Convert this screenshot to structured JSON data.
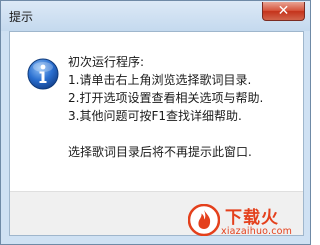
{
  "window": {
    "title": "提示",
    "close_symbol": "✕"
  },
  "message": {
    "icon": "information-icon",
    "lines": [
      "初次运行程序:",
      "1.请单击右上角浏览选择歌词目录.",
      "2.打开选项设置查看相关选项与帮助.",
      "3.其他问题可按F1查找详细帮助."
    ],
    "footer": "选择歌词目录后将不再提示此窗口."
  },
  "watermark": {
    "brand": "下载火",
    "url": "xiazaihuo.com"
  },
  "colors": {
    "title_bar": "#c4d9ee",
    "close_button": "#c4331b",
    "icon_blue": "#1e5fb8",
    "watermark": "#e4401c"
  }
}
